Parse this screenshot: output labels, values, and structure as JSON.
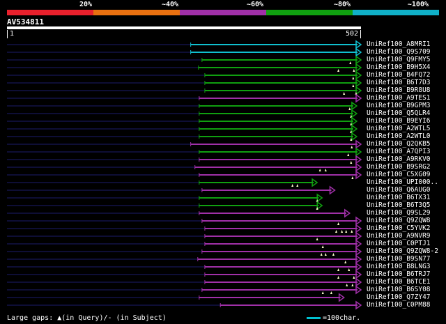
{
  "legend": {
    "labels": [
      "20%",
      "~40%",
      "~60%",
      "~80%",
      "~100%"
    ],
    "colors": [
      "#e8202c",
      "#e87010",
      "#a030a8",
      "#10a010",
      "#10b0c8"
    ]
  },
  "query": {
    "id": "AV534811",
    "start": "1",
    "end": "502",
    "length": 502
  },
  "colors": {
    "cyan": "#10c0d0",
    "green": "#10a010",
    "purple": "#a030a8",
    "navy": "#1c1c6c"
  },
  "hits": [
    {
      "label": "UniRef100_A8MRI1",
      "color": "cyan",
      "start": 261,
      "end": 502,
      "gaps": []
    },
    {
      "label": "UniRef100_Q9S709",
      "color": "cyan",
      "start": 261,
      "end": 502,
      "gaps": []
    },
    {
      "label": "UniRef100_Q9FMY5",
      "color": "green",
      "start": 277,
      "end": 502,
      "gaps": [
        487
      ]
    },
    {
      "label": "UniRef100_B9H5X4",
      "color": "green",
      "start": 272,
      "end": 502,
      "gaps": [
        470,
        492
      ]
    },
    {
      "label": "UniRef100_B4FQ72",
      "color": "green",
      "start": 281,
      "end": 502,
      "gaps": [
        491
      ]
    },
    {
      "label": "UniRef100_B6T7D3",
      "color": "green",
      "start": 281,
      "end": 502,
      "gaps": [
        491
      ]
    },
    {
      "label": "UniRef100_B9R8U8",
      "color": "green",
      "start": 281,
      "end": 502,
      "gaps": [
        478,
        495
      ]
    },
    {
      "label": "UniRef100_A9TES1",
      "color": "purple",
      "start": 273,
      "end": 502,
      "gaps": []
    },
    {
      "label": "UniRef100_B9GPM3",
      "color": "green",
      "start": 273,
      "end": 496,
      "gaps": [
        486
      ]
    },
    {
      "label": "UniRef100_Q5QLR4",
      "color": "green",
      "start": 273,
      "end": 496,
      "gaps": [
        488
      ]
    },
    {
      "label": "UniRef100_B9EYI6",
      "color": "green",
      "start": 273,
      "end": 496,
      "gaps": [
        488
      ]
    },
    {
      "label": "UniRef100_A2WTL5",
      "color": "green",
      "start": 273,
      "end": 496,
      "gaps": [
        488
      ]
    },
    {
      "label": "UniRef100_A2WTL0",
      "color": "green",
      "start": 273,
      "end": 496,
      "gaps": [
        488
      ]
    },
    {
      "label": "UniRef100_Q2QKB5",
      "color": "purple",
      "start": 261,
      "end": 502,
      "gaps": [
        489
      ]
    },
    {
      "label": "UniRef100_A7QPI3",
      "color": "green",
      "start": 273,
      "end": 502,
      "gaps": [
        484
      ]
    },
    {
      "label": "UniRef100_A9RKV0",
      "color": "purple",
      "start": 273,
      "end": 502,
      "gaps": [
        488
      ]
    },
    {
      "label": "UniRef100_B9SRG2",
      "color": "purple",
      "start": 267,
      "end": 502,
      "gaps": [
        444,
        452
      ]
    },
    {
      "label": "UniRef100_C5XG09",
      "color": "purple",
      "start": 273,
      "end": 502,
      "gaps": [
        490
      ]
    },
    {
      "label": "UniRef100_UPI000..",
      "color": "green",
      "start": 273,
      "end": 440,
      "gaps": [
        405,
        412
      ]
    },
    {
      "label": "UniRef100_Q6AUG0",
      "color": "purple",
      "start": 277,
      "end": 465,
      "gaps": []
    },
    {
      "label": "UniRef100_B6TX31",
      "color": "green",
      "start": 273,
      "end": 447,
      "gaps": [
        440
      ]
    },
    {
      "label": "UniRef100_B6T3Q5",
      "color": "green",
      "start": 273,
      "end": 447,
      "gaps": [
        440
      ]
    },
    {
      "label": "UniRef100_Q9SL29",
      "color": "purple",
      "start": 273,
      "end": 486,
      "gaps": []
    },
    {
      "label": "UniRef100_Q9ZQW8",
      "color": "purple",
      "start": 277,
      "end": 502,
      "gaps": [
        470
      ]
    },
    {
      "label": "UniRef100_C5YVK2",
      "color": "purple",
      "start": 281,
      "end": 502,
      "gaps": [
        467,
        475,
        481,
        489
      ]
    },
    {
      "label": "UniRef100_A9NVR9",
      "color": "purple",
      "start": 281,
      "end": 502,
      "gaps": [
        440
      ]
    },
    {
      "label": "UniRef100_C0PTJ1",
      "color": "purple",
      "start": 281,
      "end": 502,
      "gaps": [
        448
      ]
    },
    {
      "label": "UniRef100_Q9ZQW8-2",
      "color": "purple",
      "start": 277,
      "end": 502,
      "gaps": [
        446,
        452,
        463
      ]
    },
    {
      "label": "UniRef100_B9SN77",
      "color": "purple",
      "start": 271,
      "end": 502,
      "gaps": [
        480
      ]
    },
    {
      "label": "UniRef100_B8LNG3",
      "color": "purple",
      "start": 281,
      "end": 502,
      "gaps": [
        470,
        485
      ]
    },
    {
      "label": "UniRef100_B6TRJ7",
      "color": "purple",
      "start": 281,
      "end": 502,
      "gaps": [
        470,
        492
      ]
    },
    {
      "label": "UniRef100_B6TCE1",
      "color": "purple",
      "start": 281,
      "end": 502,
      "gaps": [
        482,
        490
      ]
    },
    {
      "label": "UniRef100_B6SY08",
      "color": "purple",
      "start": 277,
      "end": 502,
      "gaps": [
        448,
        460
      ]
    },
    {
      "label": "UniRef100_Q7ZY47",
      "color": "purple",
      "start": 273,
      "end": 478,
      "gaps": []
    },
    {
      "label": "UniRef100_C0PM88",
      "color": "purple",
      "start": 303,
      "end": 502,
      "gaps": []
    }
  ],
  "footer": {
    "gaps_text": "Large gaps: ▲(in Query)/- (in Subject)",
    "scale_text": "=100char."
  }
}
